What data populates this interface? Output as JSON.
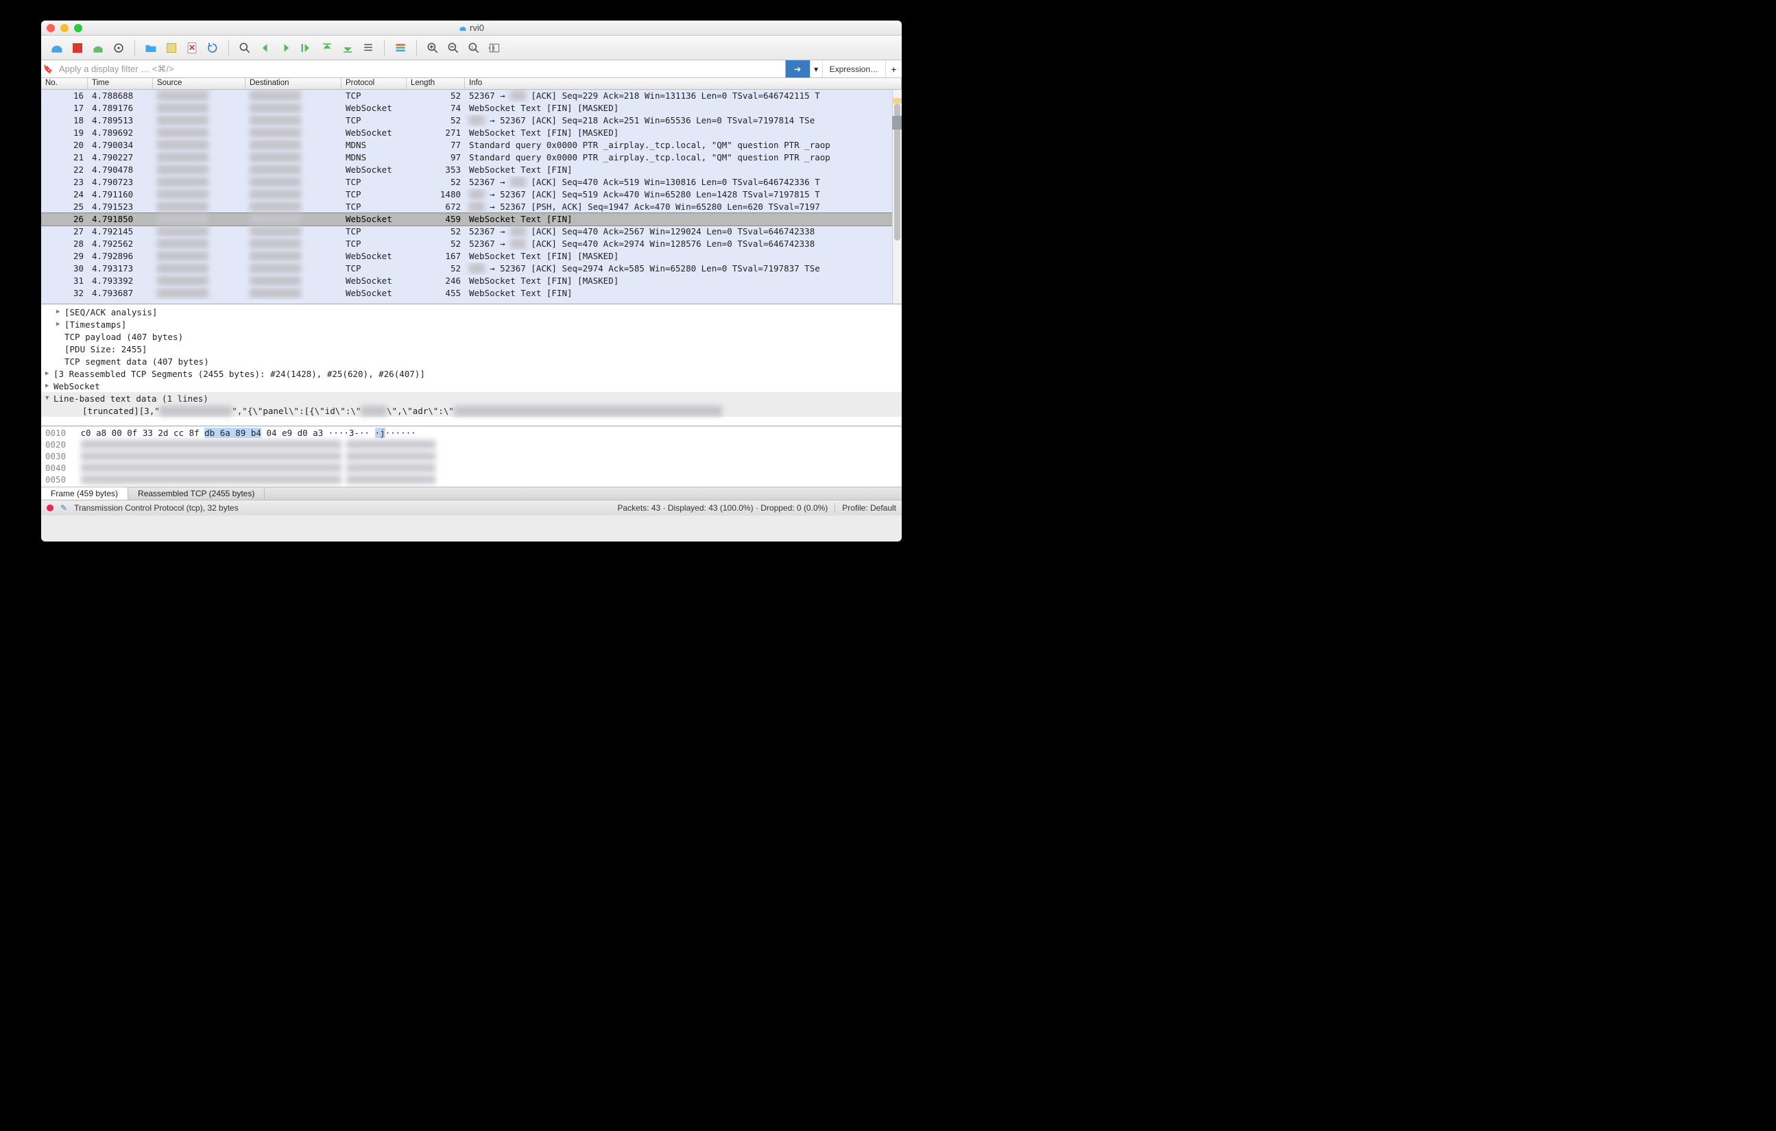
{
  "window": {
    "title": "rvi0"
  },
  "filter": {
    "placeholder": "Apply a display filter … <⌘/>",
    "expression_label": "Expression…"
  },
  "columns": {
    "no": "No.",
    "time": "Time",
    "source": "Source",
    "destination": "Destination",
    "protocol": "Protocol",
    "length": "Length",
    "info": "Info"
  },
  "packets": [
    {
      "no": "16",
      "time": "4.788688",
      "proto": "TCP",
      "len": "52",
      "info": "52367 → ███  [ACK] Seq=229 Ack=218 Win=131136 Len=0 TSval=646742115 T"
    },
    {
      "no": "17",
      "time": "4.789176",
      "proto": "WebSocket",
      "len": "74",
      "info": "WebSocket Text [FIN] [MASKED]"
    },
    {
      "no": "18",
      "time": "4.789513",
      "proto": "TCP",
      "len": "52",
      "info": "███ → 52367 [ACK] Seq=218 Ack=251 Win=65536 Len=0 TSval=7197814 TSe"
    },
    {
      "no": "19",
      "time": "4.789692",
      "proto": "WebSocket",
      "len": "271",
      "info": "WebSocket Text [FIN] [MASKED]"
    },
    {
      "no": "20",
      "time": "4.790034",
      "proto": "MDNS",
      "len": "77",
      "info": "Standard query 0x0000 PTR _airplay._tcp.local, \"QM\" question PTR _raop"
    },
    {
      "no": "21",
      "time": "4.790227",
      "proto": "MDNS",
      "len": "97",
      "info": "Standard query 0x0000 PTR _airplay._tcp.local, \"QM\" question PTR _raop"
    },
    {
      "no": "22",
      "time": "4.790478",
      "proto": "WebSocket",
      "len": "353",
      "info": "WebSocket Text [FIN]"
    },
    {
      "no": "23",
      "time": "4.790723",
      "proto": "TCP",
      "len": "52",
      "info": "52367 → ███  [ACK] Seq=470 Ack=519 Win=130816 Len=0 TSval=646742336 T"
    },
    {
      "no": "24",
      "time": "4.791160",
      "proto": "TCP",
      "len": "1480",
      "info": "███ → 52367 [ACK] Seq=519 Ack=470 Win=65280 Len=1428 TSval=7197815 T"
    },
    {
      "no": "25",
      "time": "4.791523",
      "proto": "TCP",
      "len": "672",
      "info": "███ → 52367 [PSH, ACK] Seq=1947 Ack=470 Win=65280 Len=620 TSval=7197"
    },
    {
      "no": "26",
      "time": "4.791850",
      "proto": "WebSocket",
      "len": "459",
      "info": "WebSocket Text [FIN]",
      "selected": true
    },
    {
      "no": "27",
      "time": "4.792145",
      "proto": "TCP",
      "len": "52",
      "info": "52367 → ███  [ACK] Seq=470 Ack=2567 Win=129024 Len=0 TSval=646742338"
    },
    {
      "no": "28",
      "time": "4.792562",
      "proto": "TCP",
      "len": "52",
      "info": "52367 → ███  [ACK] Seq=470 Ack=2974 Win=128576 Len=0 TSval=646742338"
    },
    {
      "no": "29",
      "time": "4.792896",
      "proto": "WebSocket",
      "len": "167",
      "info": "WebSocket Text [FIN] [MASKED]"
    },
    {
      "no": "30",
      "time": "4.793173",
      "proto": "TCP",
      "len": "52",
      "info": "███ → 52367 [ACK] Seq=2974 Ack=585 Win=65280 Len=0 TSval=7197837 TSe"
    },
    {
      "no": "31",
      "time": "4.793392",
      "proto": "WebSocket",
      "len": "246",
      "info": "WebSocket Text [FIN] [MASKED]"
    },
    {
      "no": "32",
      "time": "4.793687",
      "proto": "WebSocket",
      "len": "455",
      "info": "WebSocket Text [FIN]"
    }
  ],
  "details": {
    "rows": [
      {
        "lv": 1,
        "tri": "▶",
        "text": "[SEQ/ACK analysis]"
      },
      {
        "lv": 1,
        "tri": "▶",
        "text": "[Timestamps]"
      },
      {
        "lv": 1,
        "tri": "",
        "text": "TCP payload (407 bytes)"
      },
      {
        "lv": 1,
        "tri": "",
        "text": "[PDU Size: 2455]"
      },
      {
        "lv": 1,
        "tri": "",
        "text": "TCP segment data (407 bytes)"
      },
      {
        "lv": 0,
        "tri": "▶",
        "text": "[3 Reassembled TCP Segments (2455 bytes): #24(1428), #25(620), #26(407)]"
      },
      {
        "lv": 0,
        "tri": "▶",
        "text": "WebSocket"
      },
      {
        "lv": 0,
        "tri": "▼",
        "text": "Line-based text data (1 lines)",
        "sel": true
      },
      {
        "lv": 2,
        "tri": "",
        "text": "[truncated][3,\"██████████████\",\"{\\\"panel\\\":[{\\\"id\\\":\\\"█████\\\",\\\"adr\\\":\\\"████████████████████████████████████████████████████",
        "sel": true
      }
    ]
  },
  "hex": {
    "rows": [
      {
        "off": "0010",
        "bytes_a": "c0 a8 00 0f 33 2d cc 8f",
        "bytes_b": "db 6a 89 b4",
        "bytes_c": "04 e9 d0 a3",
        "ascii": "····3-·· ·j······",
        "hl": true
      },
      {
        "off": "0020"
      },
      {
        "off": "0030"
      },
      {
        "off": "0040"
      },
      {
        "off": "0050"
      }
    ]
  },
  "bottom_tabs": {
    "frame": "Frame (459 bytes)",
    "reasm": "Reassembled TCP (2455 bytes)"
  },
  "status": {
    "left": "Transmission Control Protocol (tcp), 32 bytes",
    "right": "Packets: 43 · Displayed: 43 (100.0%) · Dropped: 0 (0.0%)",
    "profile": "Profile: Default"
  }
}
